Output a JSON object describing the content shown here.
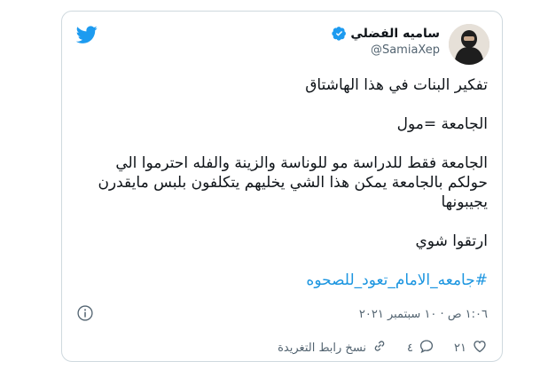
{
  "tweet": {
    "author": {
      "display_name": "ساميه الفضلي",
      "handle": "@SamiaXep"
    },
    "lines": {
      "l1": "تفكير البنات في هذا الهاشتاق",
      "l2": "الجامعة =مول",
      "l3": "الجامعة فقط للدراسة مو للوناسة والزينة والفله  احترموا الي حولكم بالجامعة يمكن هذا الشي يخليهم يتكلفون بلبس مايقدرن يجيبونها",
      "l4": "ارتقوا شوي",
      "hashtag": "#جامعه_الامام_تعود_للصحوه"
    },
    "timestamp": "١:٠٦ ص · ١٠ سبتمبر ٢٠٢١",
    "actions": {
      "likes": "٢١",
      "replies": "٤",
      "copy_link": "نسخ رابط التغريدة"
    }
  },
  "colors": {
    "accent": "#1d9bf0",
    "hashtag": "#1b95e0",
    "text": "#0f1419",
    "muted": "#536471",
    "border": "#cfd9de"
  },
  "icons": [
    "twitter-bird-icon",
    "verified-badge-icon",
    "info-icon",
    "heart-icon",
    "reply-icon",
    "link-icon"
  ]
}
